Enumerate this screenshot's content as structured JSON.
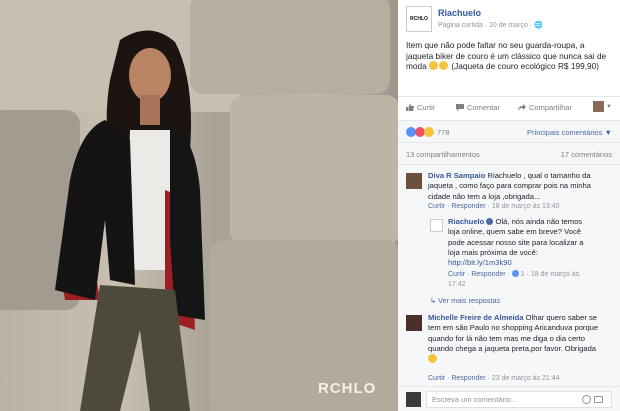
{
  "photo": {
    "watermark": "RCHLO"
  },
  "post": {
    "avatar_text": "RCHLO",
    "page_name": "Riachuelo",
    "meta": "Página curtida · 10 de março · 🌐",
    "caption": "Item que não pode faltar no seu guarda-roupa, a jaqueta biker de couro é um clássico que nunca sai de moda",
    "caption_tail": "(Jaqueta de couro ecológico R$ 199,90)"
  },
  "actions": {
    "like": "Curtir",
    "comment": "Comentar",
    "share": "Compartilhar",
    "caret": "▼"
  },
  "reactions": {
    "count": "778",
    "sort": "Principais comentários ▼"
  },
  "counts": {
    "shares": "13 compartilhamentos",
    "comments": "17 comentários"
  },
  "comments": [
    {
      "author": "Diva R Sampaio",
      "text_1": "Riachuelo , qual o tamanho da",
      "text_2": "jaqueta , como faço para comprar pois na minha",
      "text_3": "cidade não tem a loja ,obrigada...",
      "foot_like": "Curtir",
      "foot_reply": "Responder",
      "foot_date": "18 de março às 13:40"
    },
    {
      "author": "Riachuelo",
      "text_1": "Olá, nós ainda não temos",
      "text_2": "loja online, quem sabe em breve? Você",
      "text_3": "pode acessar nosso site para localizar a",
      "text_4": "loja mais próxima de você:",
      "link": "http://bit.ly/1m3k90",
      "foot_like": "Curtir",
      "foot_reply": "Responder",
      "foot_likes": "1",
      "foot_date": "18 de março às",
      "foot_time": "17:42"
    },
    {
      "author": "Michelle Freire de Almeida",
      "text_1": "Olhar quero saber se",
      "text_2": "tem em são Paulo no shopping Aricanduva porque",
      "text_3": "quando for lá não tem mas me diga o dia certo",
      "text_4": "quando chega a jaqueta preta,por favor. Obrigada",
      "foot_like": "Curtir",
      "foot_reply": "Responder",
      "foot_date": "23 de março às 21:44"
    }
  ],
  "more_replies": "Ver mais respostas",
  "composer": {
    "placeholder": "Escreva um comentário..."
  },
  "colors": {
    "link": "#365899",
    "like_blue": "#5890ff",
    "love_red": "#f25268",
    "haha_yellow": "#f5c33b"
  }
}
